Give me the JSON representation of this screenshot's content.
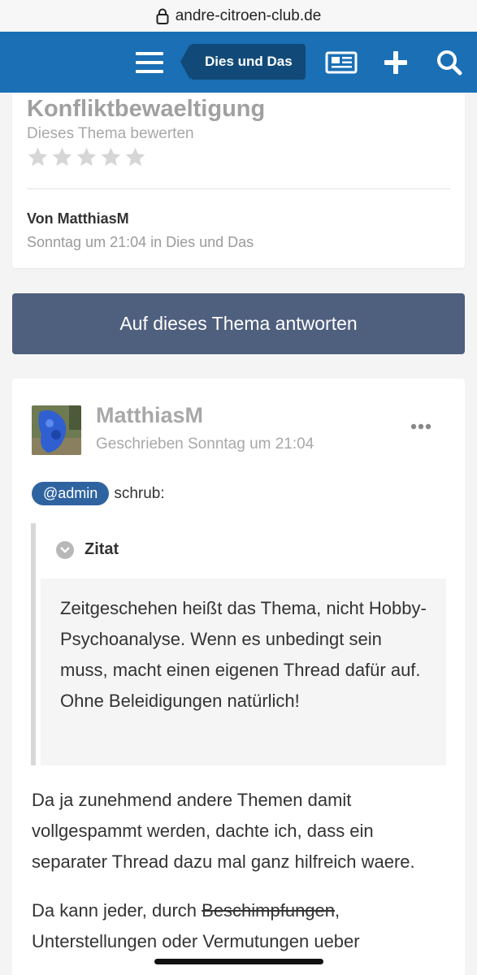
{
  "browser": {
    "url": "andre-citroen-club.de"
  },
  "header": {
    "breadcrumb": "Dies und Das",
    "accent": "#1a6fb5"
  },
  "topic": {
    "title": "Konfliktbewaeltigung",
    "rate_label": "Dieses Thema bewerten",
    "rating": 0,
    "rating_max": 5,
    "author_line": "Von MatthiasM",
    "date_line": "Sonntag um 21:04 in Dies und Das"
  },
  "reply_button": "Auf dieses Thema antworten",
  "post": {
    "author": "MatthiasM",
    "date": "Geschrieben Sonntag um 21:04",
    "mention": "@admin",
    "mention_suffix": "schrub:",
    "quote_label": "Zitat",
    "quote_text": "Zeitgeschehen heißt das Thema, nicht Hobby-Psychoanalyse. Wenn es unbedingt sein muss, macht einen eigenen Thread dafür auf. Ohne Beleidigungen natürlich!",
    "paragraph1": "Da ja zunehmend andere Themen damit vollgespammt werden, dachte ich, dass ein separater Thread dazu mal ganz hilfreich waere.",
    "paragraph2_start": "Da kann jeder, durch ",
    "paragraph2_strike": "Beschimpfungen",
    "paragraph2_rest": ", Unterstellungen oder Vermutungen ueber"
  }
}
